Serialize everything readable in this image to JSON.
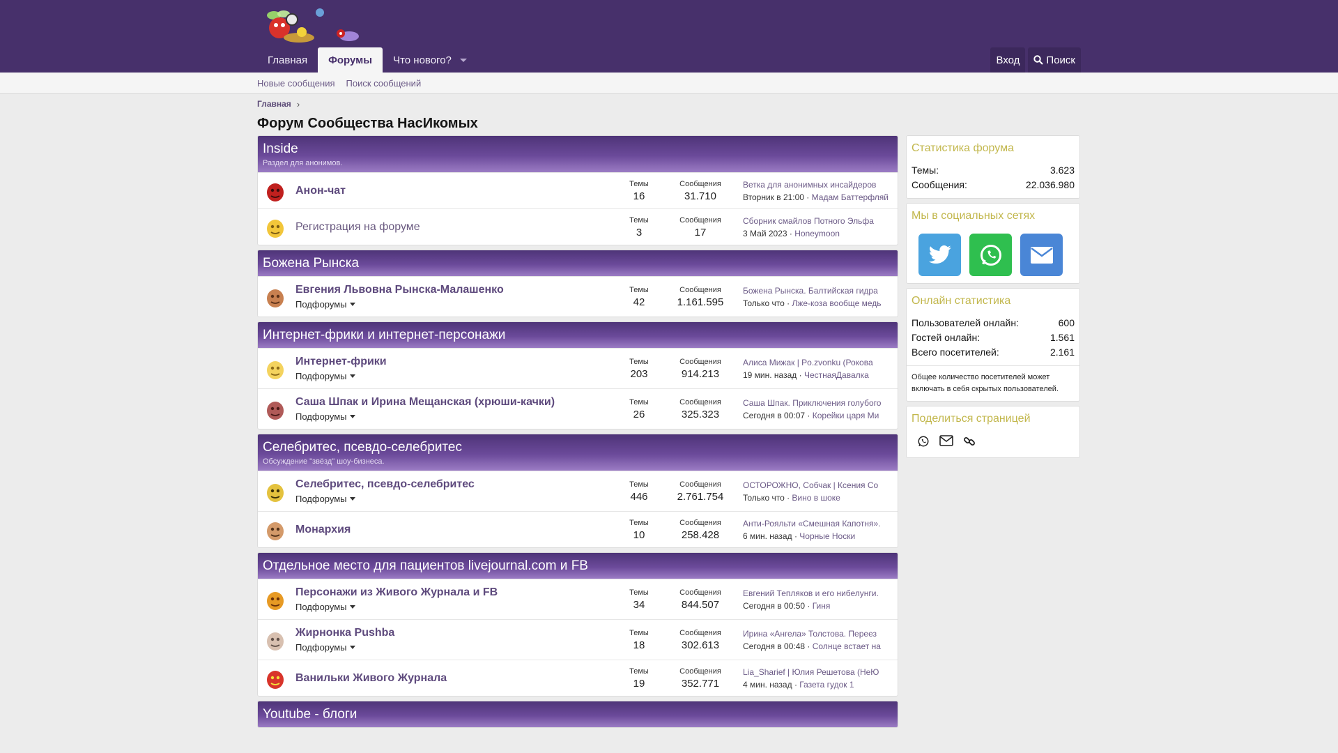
{
  "header": {
    "nav": [
      {
        "label": "Главная"
      },
      {
        "label": "Форумы"
      },
      {
        "label": "Что нового?"
      }
    ],
    "login": "Вход",
    "search": "Поиск"
  },
  "subnav": [
    "Новые сообщения",
    "Поиск сообщений"
  ],
  "breadcrumb": "Главная",
  "page_title": "Форум Сообщества НасИкомых",
  "labels": {
    "threads": "Темы",
    "messages": "Сообщения",
    "subforums": "Подфорумы"
  },
  "categories": [
    {
      "title": "Inside",
      "desc": "Раздел для анонимов.",
      "nodes": [
        {
          "title": "Анон-чат",
          "threads": "16",
          "messages": "31.710",
          "last_title": "Ветка для анонимных инсайдеров",
          "last_time": "Вторник в 21:00",
          "last_user": "Мадам Баттерфляй"
        },
        {
          "title": "Регистрация на форуме",
          "threads": "3",
          "messages": "17",
          "last_title": "Сборник смайлов Потного Эльфа",
          "last_time": "3 Май 2023",
          "last_user": "Honeymoon"
        }
      ]
    },
    {
      "title": "Божена Рынска",
      "nodes": [
        {
          "title": "Евгения Львовна Рынска-Малашенко",
          "threads": "42",
          "messages": "1.161.595",
          "last_title": "Божена Рынска. Балтийская гидра",
          "last_time": "Только что",
          "last_user": "Лже-коза вообще медь"
        }
      ]
    },
    {
      "title": "Интернет-фрики и интернет-персонажи",
      "nodes": [
        {
          "title": "Интернет-фрики",
          "threads": "203",
          "messages": "914.213",
          "last_title": "Алиса Мижак | Po.zvonku (Рокова",
          "last_time": "19 мин. назад",
          "last_user": "ЧестнаяДавалка"
        },
        {
          "title": "Саша Шпак и Ирина Мещанская (хрюши-качки)",
          "threads": "26",
          "messages": "325.323",
          "last_title": "Саша Шпак. Приключения голубого",
          "last_time": "Сегодня в 00:07",
          "last_user": "Корейки царя Ми"
        }
      ]
    },
    {
      "title": "Селебритес, псевдо-селебритес",
      "desc": "Обсуждение \"звёзд\" шоу-бизнеса.",
      "nodes": [
        {
          "title": "Селебритес, псевдо-селебритес",
          "threads": "446",
          "messages": "2.761.754",
          "last_title": "ОСТОРОЖНО, Собчак | Ксения Со",
          "last_time": "Только что",
          "last_user": "Вино в шоке"
        },
        {
          "title": "Монархия",
          "threads": "10",
          "messages": "258.428",
          "last_title": "Анти-Рояльти «Смешная Капотня».",
          "last_time": "6 мин. назад",
          "last_user": "Чорные Носки"
        }
      ]
    },
    {
      "title": "Отдельное место для пациентов livejournal.com и FB",
      "nodes": [
        {
          "title": "Персонажи из Живого Журнала и FB",
          "threads": "34",
          "messages": "844.507",
          "last_title": "Евгений Тепляков и его нибелунги.",
          "last_time": "Сегодня в 00:50",
          "last_user": "Гиня"
        },
        {
          "title": "Жирнонка Pushba",
          "threads": "18",
          "messages": "302.613",
          "last_title": "Ирина «Ангела» Толстова. Переез",
          "last_time": "Сегодня в 00:48",
          "last_user": "Солнце встает на"
        },
        {
          "title": "Ванильки Живого Журнала",
          "threads": "19",
          "messages": "352.771",
          "last_title": "Lia_Sharief | Юлия Решетова (НеЮ",
          "last_time": "4 мин. назад",
          "last_user": "Газета гудок 1"
        }
      ]
    },
    {
      "title": "Youtube - блоги"
    }
  ],
  "sidebar": {
    "stats_title": "Статистика форума",
    "stats": [
      {
        "label": "Темы:",
        "value": "3.623"
      },
      {
        "label": "Сообщения:",
        "value": "22.036.980"
      }
    ],
    "social_title": "Мы в социальных сетях",
    "online_title": "Онлайн статистика",
    "online": [
      {
        "label": "Пользователей онлайн:",
        "value": "600"
      },
      {
        "label": "Гостей онлайн:",
        "value": "1.561"
      },
      {
        "label": "Всего посетителей:",
        "value": "2.161"
      }
    ],
    "online_note": "Общее количество посетителей может включать в себя скрытых пользователей.",
    "share_title": "Поделиться страницей"
  },
  "colors": {
    "brand": "#47306b",
    "accent_title": "#c2b74c",
    "twitter": "#4aa3df",
    "whatsapp": "#2fbf4f",
    "email": "#4a86d6"
  }
}
